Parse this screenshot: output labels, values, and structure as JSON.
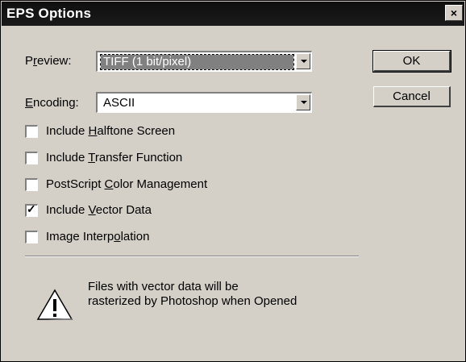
{
  "window": {
    "title": "EPS Options",
    "close_glyph": "×"
  },
  "preview": {
    "label_pre": "P",
    "label_key": "r",
    "label_post": "eview:",
    "value": "TIFF (1 bit/pixel)"
  },
  "encoding": {
    "label_pre": "",
    "label_key": "E",
    "label_post": "ncoding:",
    "value": "ASCII"
  },
  "buttons": {
    "ok": "OK",
    "cancel": "Cancel"
  },
  "options": [
    {
      "pre": "Include ",
      "key": "H",
      "post": "alftone Screen",
      "checked": false
    },
    {
      "pre": "Include ",
      "key": "T",
      "post": "ransfer Function",
      "checked": false
    },
    {
      "pre": "PostScript ",
      "key": "C",
      "post": "olor Management",
      "checked": false
    },
    {
      "pre": "Include ",
      "key": "V",
      "post": "ector Data",
      "checked": true
    },
    {
      "pre": "Image Interp",
      "key": "o",
      "post": "lation",
      "checked": false
    }
  ],
  "message": {
    "line1": "Files with vector data will be",
    "line2": "rasterized by Photoshop when Opened"
  },
  "icons": {
    "warning": "warning-triangle-icon",
    "dropdown": "chevron-down-icon",
    "close": "close-icon"
  },
  "colors": {
    "face": "#d4d0c8",
    "titlebar": "#111111",
    "highlight": "#808080"
  }
}
